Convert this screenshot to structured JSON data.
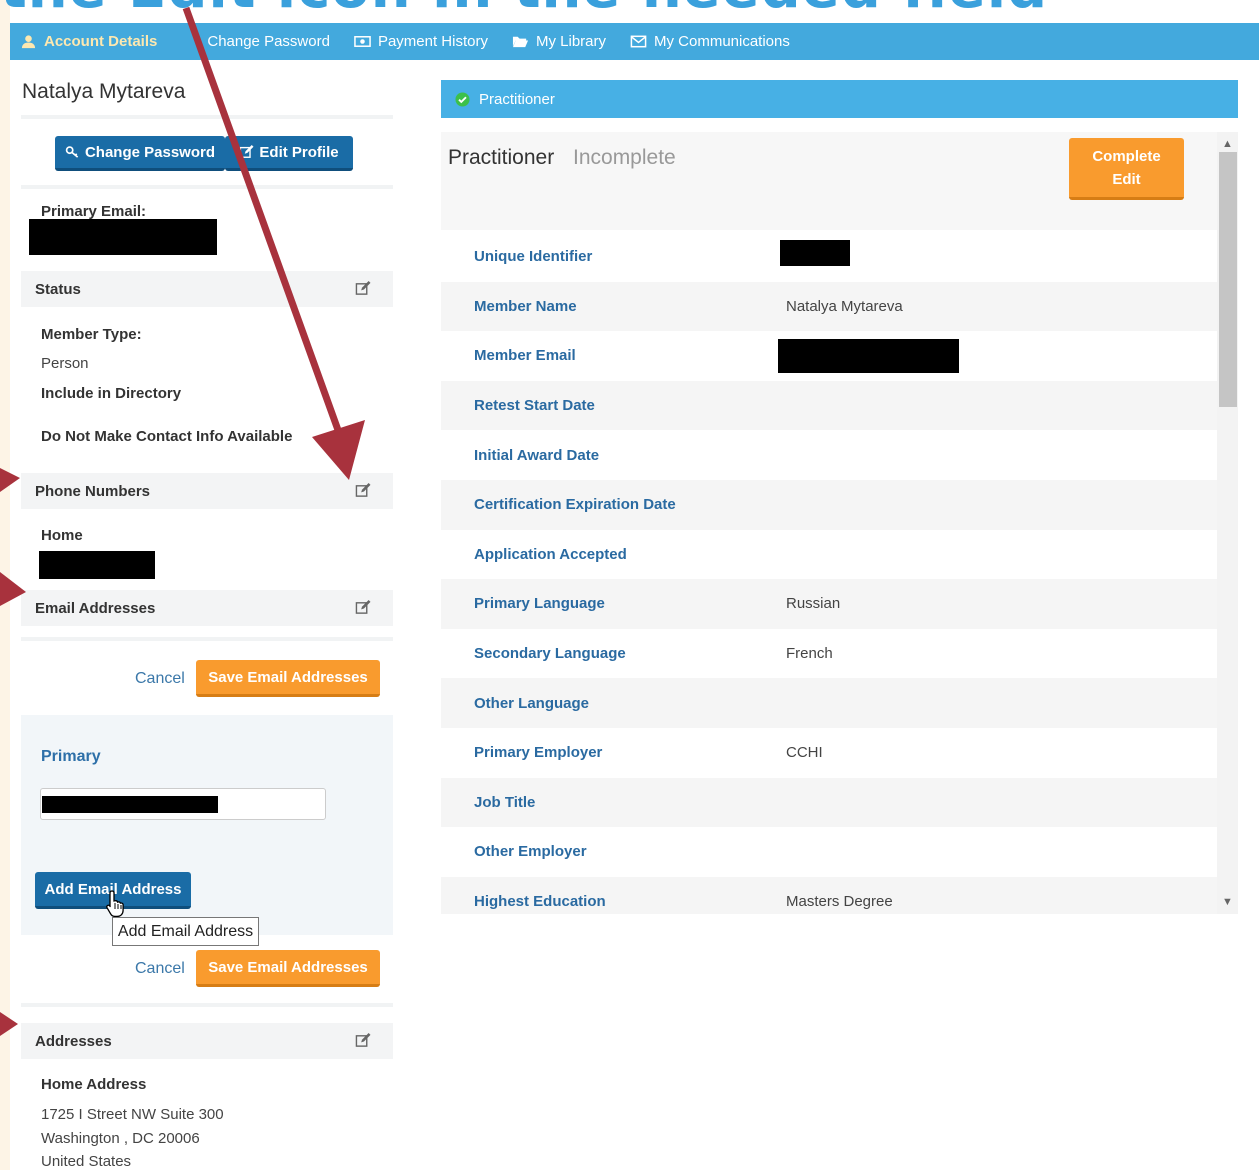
{
  "overlay_caption": "the Edit icon in the needed field",
  "nav": {
    "account_details": "Account Details",
    "change_password": "Change Password",
    "payment_history": "Payment History",
    "my_library": "My Library",
    "my_communications": "My Communications"
  },
  "profile": {
    "name": "Natalya Mytareva",
    "change_password_btn": "Change Password",
    "edit_profile_btn": "Edit Profile",
    "primary_email_label": "Primary Email:"
  },
  "status": {
    "header": "Status",
    "member_type_label": "Member Type:",
    "member_type_value": "Person",
    "include_directory": "Include in Directory",
    "no_contact": "Do Not Make Contact Info Available"
  },
  "phones": {
    "header": "Phone Numbers",
    "home_label": "Home"
  },
  "emails": {
    "header": "Email Addresses",
    "cancel": "Cancel",
    "save": "Save Email Addresses",
    "primary_label": "Primary",
    "add_btn": "Add Email Address",
    "tooltip": "Add Email Address"
  },
  "addresses": {
    "header": "Addresses",
    "home_label": "Home Address",
    "line1": "1725 I Street NW Suite 300",
    "line2": "Washington , DC 20006",
    "line3": "United States"
  },
  "practitioner": {
    "bar_label": "Practitioner",
    "title": "Practitioner",
    "status": "Incomplete",
    "complete_edit": "Complete Edit",
    "rows": [
      {
        "k": "Unique Identifier",
        "v": ""
      },
      {
        "k": "Member Name",
        "v": "Natalya Mytareva"
      },
      {
        "k": "Member Email",
        "v": ""
      },
      {
        "k": "Retest Start Date",
        "v": ""
      },
      {
        "k": "Initial Award Date",
        "v": ""
      },
      {
        "k": "Certification Expiration Date",
        "v": ""
      },
      {
        "k": "Application Accepted",
        "v": ""
      },
      {
        "k": "Primary Language",
        "v": "Russian"
      },
      {
        "k": "Secondary Language",
        "v": "French"
      },
      {
        "k": "Other Language",
        "v": ""
      },
      {
        "k": "Primary Employer",
        "v": "CCHI"
      },
      {
        "k": "Job Title",
        "v": ""
      },
      {
        "k": "Other Employer",
        "v": ""
      },
      {
        "k": "Highest Education",
        "v": "Masters Degree"
      }
    ]
  },
  "colors": {
    "nav_bg": "#43a9dd",
    "accent_orange": "#f99b2e",
    "btn_blue": "#1a6ca6",
    "arrow": "#a8323d"
  }
}
